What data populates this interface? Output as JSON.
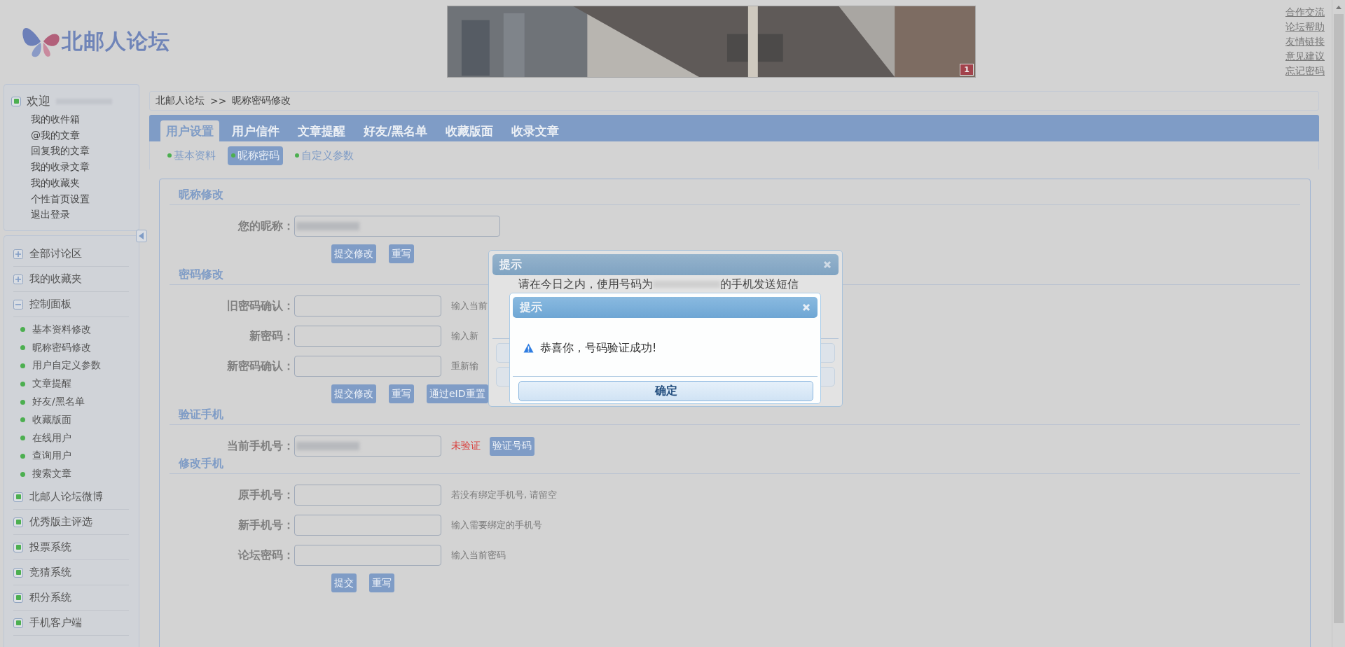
{
  "header": {
    "logo_text": "北邮人论坛",
    "banner": {
      "kind": "picture",
      "page_badge": "1"
    },
    "links": [
      "合作交流",
      "论坛帮助",
      "友情链接",
      "意见建议",
      "忘记密码"
    ]
  },
  "sidebar": {
    "welcome": {
      "title": "欢迎",
      "name_redacted": true,
      "items": [
        "我的收件箱",
        "@我的文章",
        "回复我的文章",
        "我的收录文章",
        "我的收藏夹",
        "个性首页设置",
        "退出登录"
      ]
    },
    "nav": [
      {
        "kind": "folder",
        "label": "全部讨论区",
        "expanded": false
      },
      {
        "kind": "folder",
        "label": "我的收藏夹",
        "expanded": false
      },
      {
        "kind": "folder",
        "label": "控制面板",
        "expanded": true,
        "children": [
          "基本资料修改",
          "昵称密码修改",
          "用户自定义参数",
          "文章提醒",
          "好友/黑名单",
          "收藏版面",
          "在线用户",
          "查询用户",
          "搜索文章"
        ]
      },
      {
        "kind": "link",
        "label": "北邮人论坛微博"
      },
      {
        "kind": "link",
        "label": "优秀版主评选"
      },
      {
        "kind": "link",
        "label": "投票系统"
      },
      {
        "kind": "link",
        "label": "竞猜系统"
      },
      {
        "kind": "link",
        "label": "积分系统"
      },
      {
        "kind": "link",
        "label": "手机客户端"
      }
    ]
  },
  "breadcrumb": [
    "北邮人论坛",
    ">>",
    "昵称密码修改"
  ],
  "tabs": [
    {
      "label": "用户设置",
      "selected": true
    },
    {
      "label": "用户信件",
      "selected": false
    },
    {
      "label": "文章提醒",
      "selected": false
    },
    {
      "label": "好友/黑名单",
      "selected": false
    },
    {
      "label": "收藏版面",
      "selected": false
    },
    {
      "label": "收录文章",
      "selected": false
    }
  ],
  "subtabs": [
    {
      "label": "基本资料",
      "selected": false
    },
    {
      "label": "昵称密码",
      "selected": true
    },
    {
      "label": "自定义参数",
      "selected": false
    }
  ],
  "sections": [
    {
      "title": "昵称修改",
      "fields": [
        {
          "label": "您的昵称：",
          "wide": true,
          "redacted": true
        }
      ],
      "buttons": [
        "提交修改",
        "重写"
      ]
    },
    {
      "title": "密码修改",
      "fields": [
        {
          "label": "旧密码确认：",
          "hint": "输入当前"
        },
        {
          "label": "新密码：",
          "hint": "输入新"
        },
        {
          "label": "新密码确认：",
          "hint": "重新输"
        }
      ],
      "buttons": [
        "提交修改",
        "重写",
        "通过eID重置"
      ]
    },
    {
      "title": "验证手机",
      "fields": [
        {
          "label": "当前手机号：",
          "redacted": true,
          "status": "未验证",
          "action": "验证号码"
        }
      ]
    },
    {
      "title": "修改手机",
      "fields": [
        {
          "label": "原手机号：",
          "hint": "若没有绑定手机号, 请留空"
        },
        {
          "label": "新手机号：",
          "hint": "输入需要绑定的手机号"
        },
        {
          "label": "论坛密码：",
          "hint": "输入当前密码"
        }
      ],
      "buttons": [
        "提交",
        "重写"
      ]
    }
  ],
  "dialogs": [
    {
      "title": "提示",
      "message_before": "请在今日之内，使用号码为",
      "number_redacted": true,
      "message_after": "的手机发送短信"
    },
    {
      "title": "提示",
      "message": "恭喜你，号码验证成功!",
      "button": "确定"
    }
  ]
}
